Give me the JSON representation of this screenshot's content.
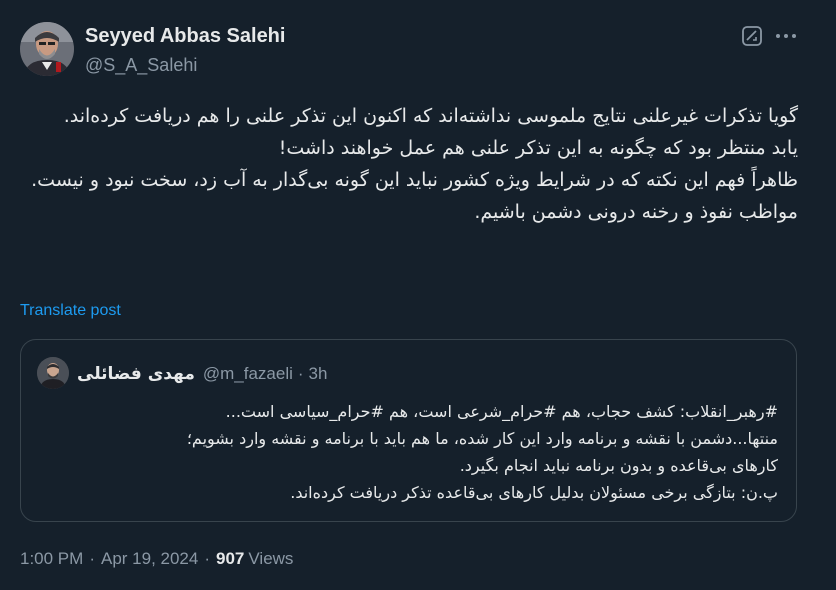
{
  "author": {
    "name": "Seyyed Abbas Salehi",
    "handle": "@S_A_Salehi"
  },
  "icons": {
    "grok": "grok-icon",
    "more": "more-horizontal-icon"
  },
  "post": {
    "lines": [
      "گویا تذکرات غیرعلنی نتایج ملموسی نداشته‌اند که اکنون این تذکر علنی را هم دریافت کرده‌اند.",
      "یابد منتظر بود که چگونه به این تذکر علنی هم عمل خواهند داشت!",
      "ظاهراً فهم این نکته که در شرایط ویژه کشور نباید این گونه بی‌گدار به آب زد، سخت نبود و نیست.",
      "مواظب  نفوذ و رخنه درونی دشمن باشیم."
    ],
    "translate_label": "Translate post"
  },
  "quote": {
    "name": "مهدی فضائلی",
    "handle": "@m_fazaeli",
    "separator": "·",
    "time": "3h",
    "lines": [
      "#رهبر_انقلاب: کشف حجاب، هم #حرام_شرعی است، هم #حرام_سیاسی است...",
      "منتها...دشمن با نقشه و برنامه وارد این کار شده، ما هم باید با برنامه و نقشه وارد بشویم؛",
      "کارهای بی‌قاعده و بدون برنامه نباید انجام بگیرد.",
      "پ.ن: بتازگی برخی مسئولان بدلیل کارهای بی‌قاعده تذکر دریافت کرده‌اند."
    ]
  },
  "meta": {
    "time": "1:00 PM",
    "separator": "·",
    "date": "Apr 19, 2024",
    "views_count": "907",
    "views_label": "Views"
  },
  "colors": {
    "background": "#15202b",
    "text": "#e7e9ea",
    "secondary": "#8b98a5",
    "link": "#1d9bf0",
    "border": "#38444d"
  }
}
